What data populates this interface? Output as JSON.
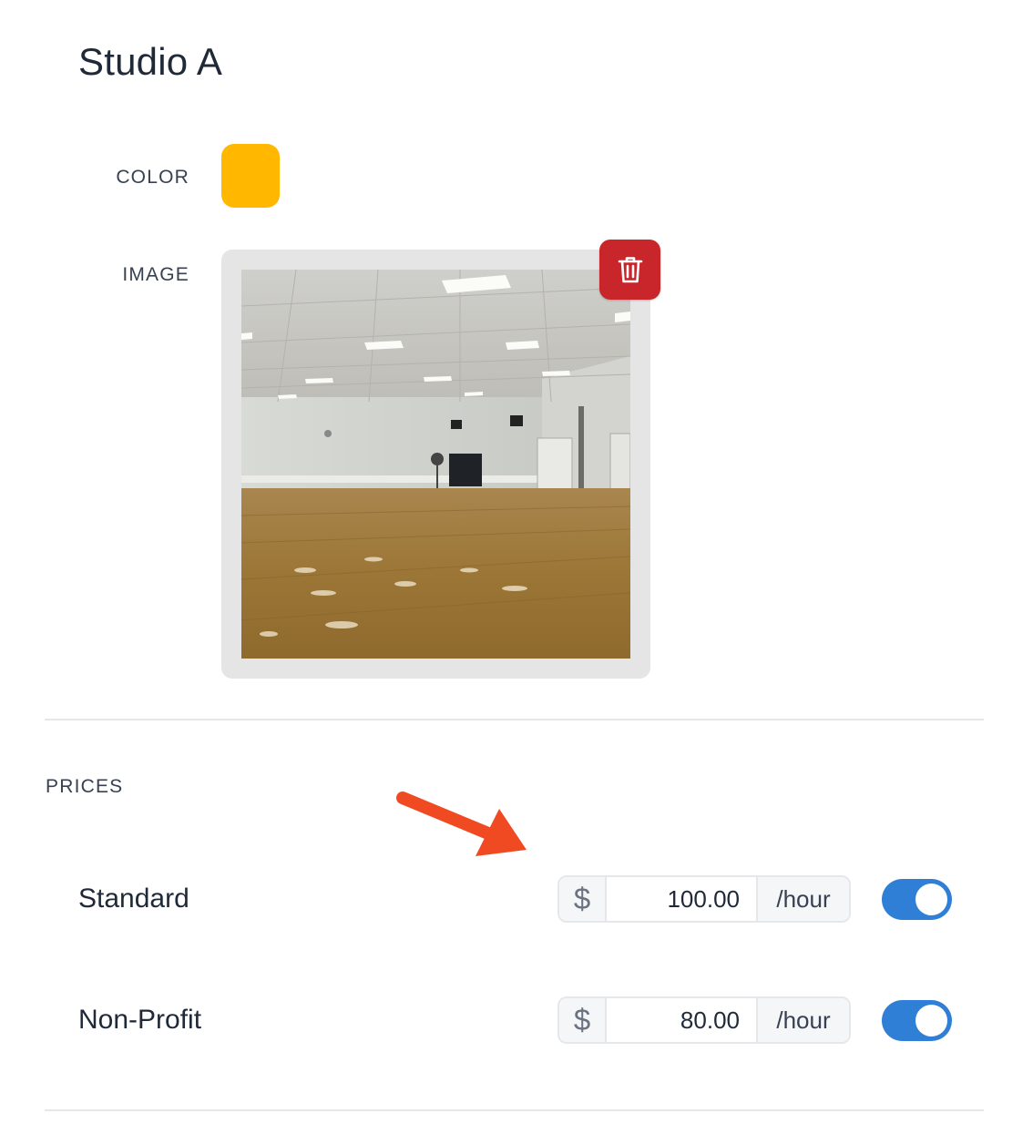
{
  "header": {
    "title": "Studio A"
  },
  "fields": {
    "color_label": "COLOR",
    "color_value": "#ffb700",
    "image_label": "IMAGE",
    "delete_icon": "trash-icon",
    "delete_button_color": "#c8262b"
  },
  "prices": {
    "section_label": "PRICES",
    "currency_symbol": "$",
    "unit": "/hour",
    "toggle_color": "#2f7fd6",
    "rows": [
      {
        "label": "Standard",
        "value": "100.00",
        "enabled": true
      },
      {
        "label": "Non-Profit",
        "value": "80.00",
        "enabled": true
      }
    ]
  },
  "annotation": {
    "arrow_color": "#f04a23"
  }
}
